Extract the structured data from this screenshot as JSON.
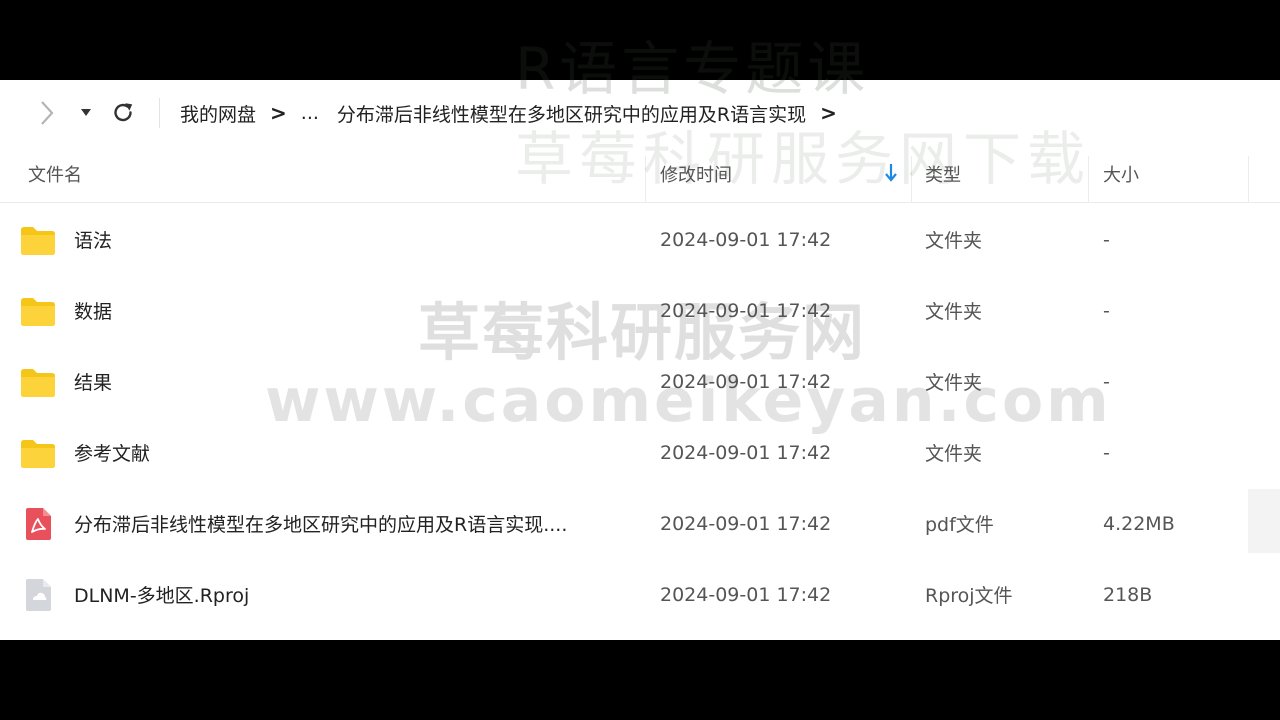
{
  "breadcrumb": {
    "root": "我的网盘",
    "ellipsis": "...",
    "current": "分布滞后非线性模型在多地区研究中的应用及R语言实现"
  },
  "columns": {
    "name": "文件名",
    "mtime": "修改时间",
    "type": "类型",
    "size": "大小"
  },
  "sort": {
    "column": "mtime",
    "direction": "descending"
  },
  "files": [
    {
      "name": "语法",
      "mtime": "2024-09-01 17:42",
      "type": "文件夹",
      "size": "-",
      "icon": "folder-icon"
    },
    {
      "name": "数据",
      "mtime": "2024-09-01 17:42",
      "type": "文件夹",
      "size": "-",
      "icon": "folder-icon"
    },
    {
      "name": "结果",
      "mtime": "2024-09-01 17:42",
      "type": "文件夹",
      "size": "-",
      "icon": "folder-icon"
    },
    {
      "name": "参考文献",
      "mtime": "2024-09-01 17:42",
      "type": "文件夹",
      "size": "-",
      "icon": "folder-icon"
    },
    {
      "name": "分布滞后非线性模型在多地区研究中的应用及R语言实现....",
      "mtime": "2024-09-01 17:42",
      "type": "pdf文件",
      "size": "4.22MB",
      "icon": "pdf-icon"
    },
    {
      "name": "DLNM-多地区.Rproj",
      "mtime": "2024-09-01 17:42",
      "type": "Rproj文件",
      "size": "218B",
      "icon": "generic-file-icon"
    }
  ],
  "watermarks": {
    "title": "R语言专题课",
    "subtitle": "草莓科研服务网下载",
    "center_cn": "草莓科研服务网",
    "center_url": "www.caomeikeyan.com"
  },
  "colors": {
    "folder": "#f5c518",
    "pdf": "#e8505b",
    "sort_arrow": "#1e88e5"
  }
}
